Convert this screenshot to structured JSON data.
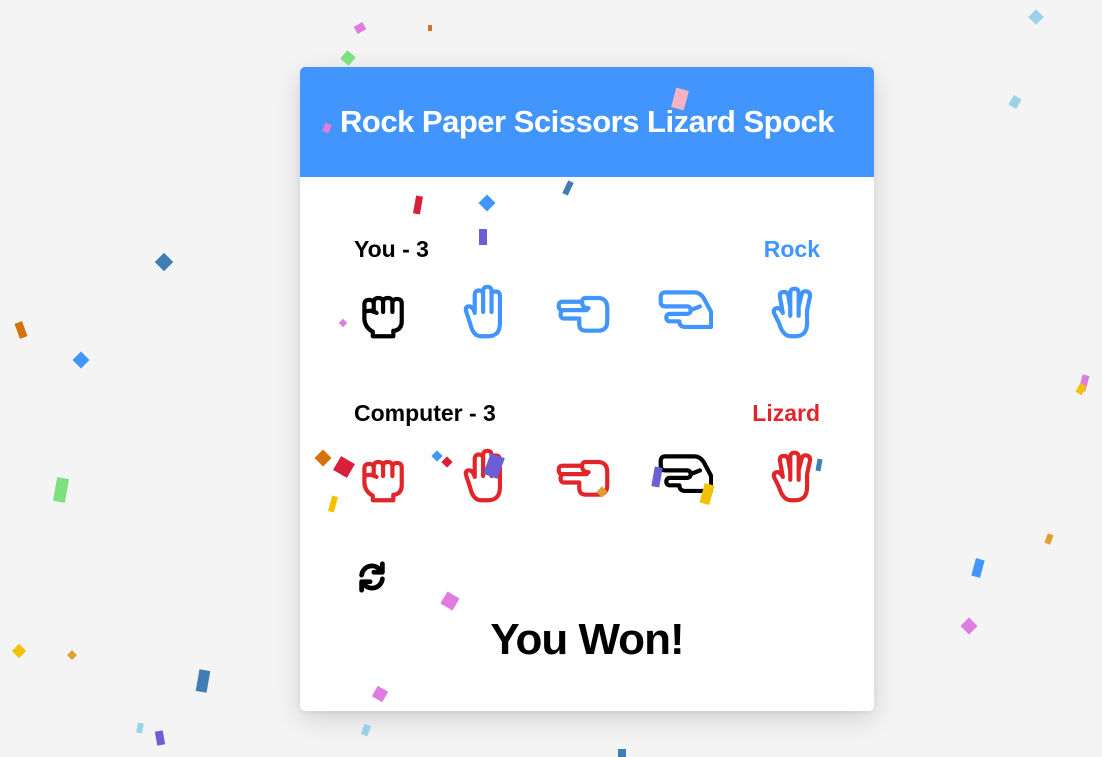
{
  "title": "Rock Paper Scissors Lizard Spock",
  "you": {
    "label": "You - 3",
    "pick": "Rock",
    "color": "#4195fc",
    "hands": [
      "rock",
      "paper",
      "scissors",
      "lizard",
      "spock"
    ],
    "selected": "rock"
  },
  "computer": {
    "label": "Computer - 3",
    "pick": "Lizard",
    "color": "#e0262b",
    "hands": [
      "rock",
      "paper",
      "scissors",
      "lizard",
      "spock"
    ],
    "selected": "lizard"
  },
  "refresh_icon": "refresh-icon",
  "result": "You Won!",
  "colors": {
    "header": "#4195fc",
    "you": "#4195fc",
    "computer": "#e0262b",
    "selected": "#000000",
    "background": "#f4f4f5"
  }
}
